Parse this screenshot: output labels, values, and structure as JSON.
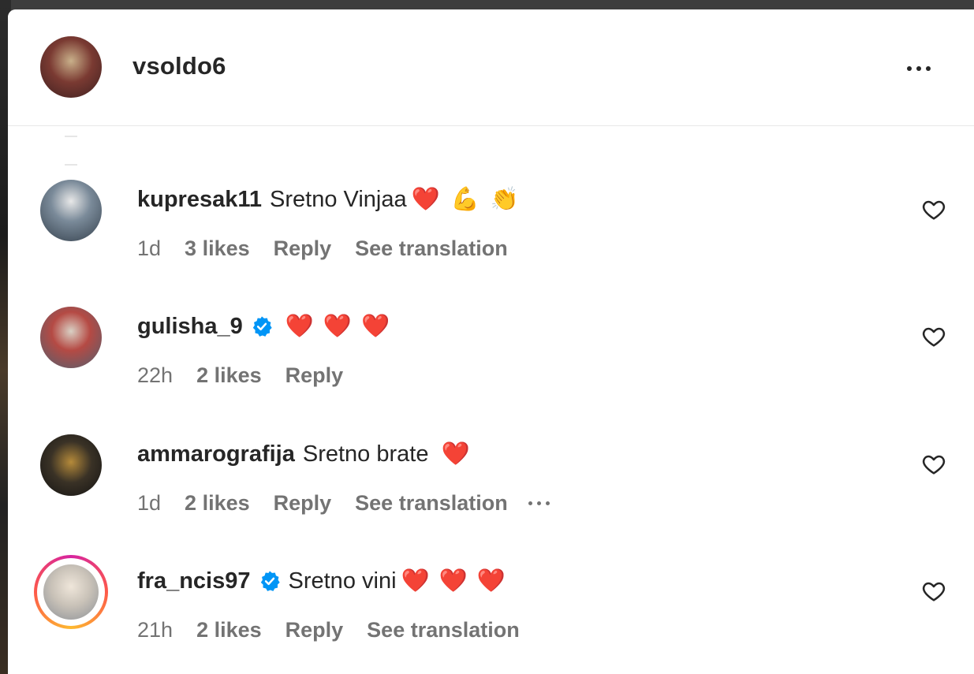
{
  "header": {
    "username": "vsoldo6"
  },
  "comments": [
    {
      "username": "kupresak11",
      "verified": false,
      "text": "Sretno Vinjaa",
      "emojis": [
        "❤️",
        "💪",
        "👏"
      ],
      "time": "1d",
      "likes": "3 likes",
      "reply": "Reply",
      "translation": "See translation"
    },
    {
      "username": "gulisha_9",
      "verified": true,
      "text": "",
      "emojis": [
        "❤️",
        "❤️",
        "❤️"
      ],
      "time": "22h",
      "likes": "2 likes",
      "reply": "Reply",
      "translation": ""
    },
    {
      "username": "ammarografija",
      "verified": false,
      "text": "Sretno brate",
      "emojis": [
        "❤️"
      ],
      "time": "1d",
      "likes": "2 likes",
      "reply": "Reply",
      "translation": "See translation"
    },
    {
      "username": "fra_ncis97",
      "verified": true,
      "text": "Sretno vini",
      "emojis": [
        "❤️",
        "❤️",
        "❤️"
      ],
      "time": "21h",
      "likes": "2 likes",
      "reply": "Reply",
      "translation": "See translation"
    }
  ],
  "colors": {
    "text": "#262626",
    "meta": "#737373",
    "verified": "#0095f6",
    "heart": "#ed4956"
  }
}
